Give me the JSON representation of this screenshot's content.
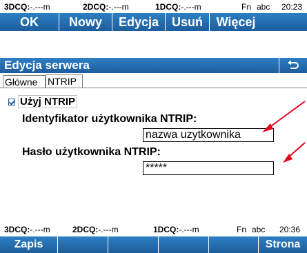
{
  "top_status": {
    "dcq3_label": "3DCQ:",
    "dcq3_value": "-.---m",
    "dcq2_label": "2DCQ:",
    "dcq2_value": "-.---m",
    "dcq1_label": "1DCQ:",
    "dcq1_value": "-.---m",
    "fn": "Fn",
    "mode": "abc",
    "time": "20:23"
  },
  "top_softkeys": [
    "OK",
    "Nowy",
    "Edycja",
    "Usuń",
    "Więcej"
  ],
  "window": {
    "title": "Edycja serwera"
  },
  "tabs": [
    "Główne",
    "NTRIP"
  ],
  "form": {
    "use_ntrip_label": "Użyj NTRIP",
    "user_id_label": "Identyfikator użytkownika NTRIP:",
    "user_id_value": "nazwa uzytkownika",
    "password_label": "Hasło użytkownika NTRIP:",
    "password_value": "*****"
  },
  "bottom_status": {
    "dcq3_label": "3DCQ:",
    "dcq3_value": "-.---m",
    "dcq2_label": "2DCQ:",
    "dcq2_value": "-.---m",
    "dcq1_label": "1DCQ:",
    "dcq1_value": "-.---m",
    "fn": "Fn",
    "mode": "abc",
    "time": "20:36"
  },
  "bottom_softkeys": [
    "Zapis",
    "",
    "",
    "",
    "",
    "Strona"
  ],
  "colors": {
    "bar_blue": "#1d5d9c",
    "arrow_red": "#e8001c"
  }
}
